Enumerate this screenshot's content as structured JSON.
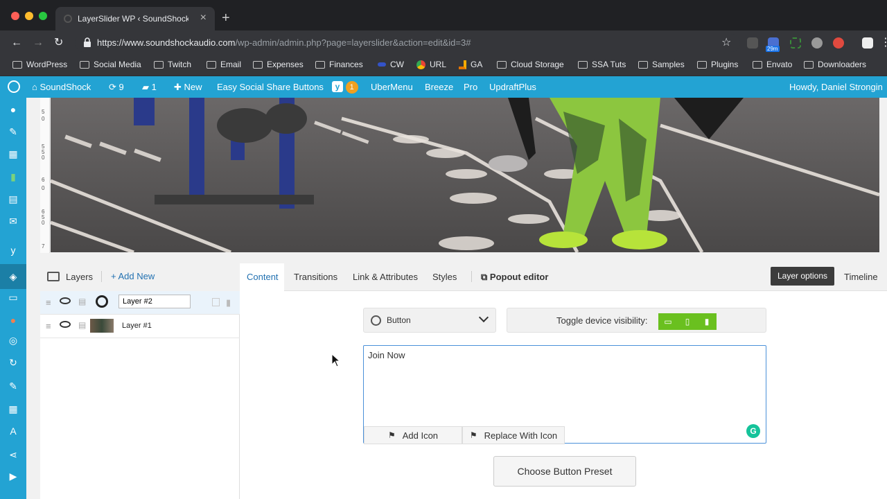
{
  "browser": {
    "tab_title": "LayerSlider WP ‹ SoundShock",
    "tab_close": "×",
    "new_tab": "+",
    "url_host": "https://www.soundshockaudio.com",
    "url_path": "/wp-admin/admin.php?page=layerslider&action=edit&id=3#",
    "ext_badge": "29m"
  },
  "bookmarks": [
    {
      "label": "WordPress"
    },
    {
      "label": "Social Media"
    },
    {
      "label": "Twitch"
    },
    {
      "label": "Email"
    },
    {
      "label": "Expenses"
    },
    {
      "label": "Finances"
    },
    {
      "label": "CW"
    },
    {
      "label": "URL"
    },
    {
      "label": "GA"
    },
    {
      "label": "Cloud Storage"
    },
    {
      "label": "SSA Tuts"
    },
    {
      "label": "Samples"
    },
    {
      "label": "Plugins"
    },
    {
      "label": "Envato"
    },
    {
      "label": "Downloaders"
    }
  ],
  "adminbar": {
    "site_name": "SoundShock",
    "updates_count": "9",
    "comments_count": "1",
    "new_label": "New",
    "essb_label": "Easy Social Share Buttons",
    "yoast_badge": "1",
    "ubermenu_label": "UberMenu",
    "breeze_label": "Breeze",
    "pro_label": "Pro",
    "updraft_label": "UpdraftPlus",
    "howdy": "Howdy, Daniel Strongin"
  },
  "ruler": {
    "marks": [
      "5",
      "0",
      "5",
      "5",
      "0",
      "6",
      "0",
      "6",
      "5",
      "0",
      "7"
    ]
  },
  "layers": {
    "title": "Layers",
    "add_new": "Add New",
    "items": [
      {
        "name": "Layer #2"
      },
      {
        "name": "Layer #1"
      }
    ]
  },
  "editor": {
    "tabs": [
      "Content",
      "Transitions",
      "Link & Attributes",
      "Styles"
    ],
    "popout": "Popout editor",
    "layer_options": "Layer options",
    "timeline": "Timeline",
    "layer_type": "Button",
    "toggle_visibility": "Toggle device visibility:",
    "content_text": "Join Now",
    "add_icon": "Add Icon",
    "replace_icon": "Replace With Icon",
    "preset": "Choose Button Preset",
    "grammarly": "G"
  },
  "colors": {
    "wp_blue": "#23a3d3",
    "device_green": "#6ac01f",
    "link_blue": "#2271b1"
  }
}
